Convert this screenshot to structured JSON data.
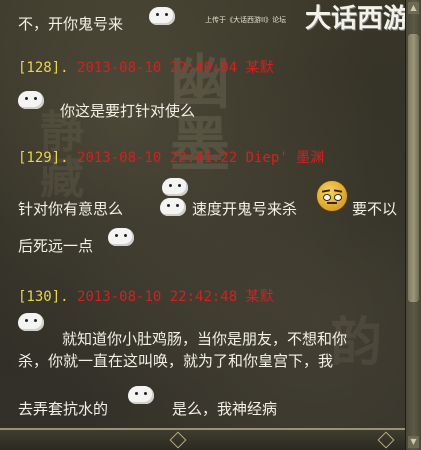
{
  "banner": {
    "small_text": "上传于《大话西游II》论坛",
    "logo_text": "大话西游II"
  },
  "watermark": {
    "chars_a": "幽 墨",
    "chars_b": "静 藏",
    "chars_c": "韵"
  },
  "messages": [
    {
      "line_1": "不，开你鬼号来"
    },
    {
      "index": "[128].",
      "datetime": "2013-08-10 22:40:04",
      "sender": "某默",
      "line_1": "你这是要打针对使么"
    },
    {
      "index": "[129].",
      "datetime": "2013-08-10 22:41:22",
      "sender": "Diep' 墨渊",
      "line_1": "针对你有意思么",
      "line_1b": "速度开鬼号来杀",
      "line_1c": "要不以",
      "line_2": "后死远一点"
    },
    {
      "index": "[130].",
      "datetime": "2013-08-10 22:42:48",
      "sender": "某默",
      "line_1": "就知道你小肚鸡肠，当你是朋友，不想和你",
      "line_2": "杀，你就一直在这叫唤，就为了和你皇宫下，我",
      "line_3": "去弄套抗水的",
      "line_3b": "是么，我神经病"
    }
  ],
  "emotes": {
    "sheep": "sheep-emote",
    "face": "skeptical-face-emote"
  },
  "scrollbar": {
    "up": "▲",
    "down": "▼"
  }
}
